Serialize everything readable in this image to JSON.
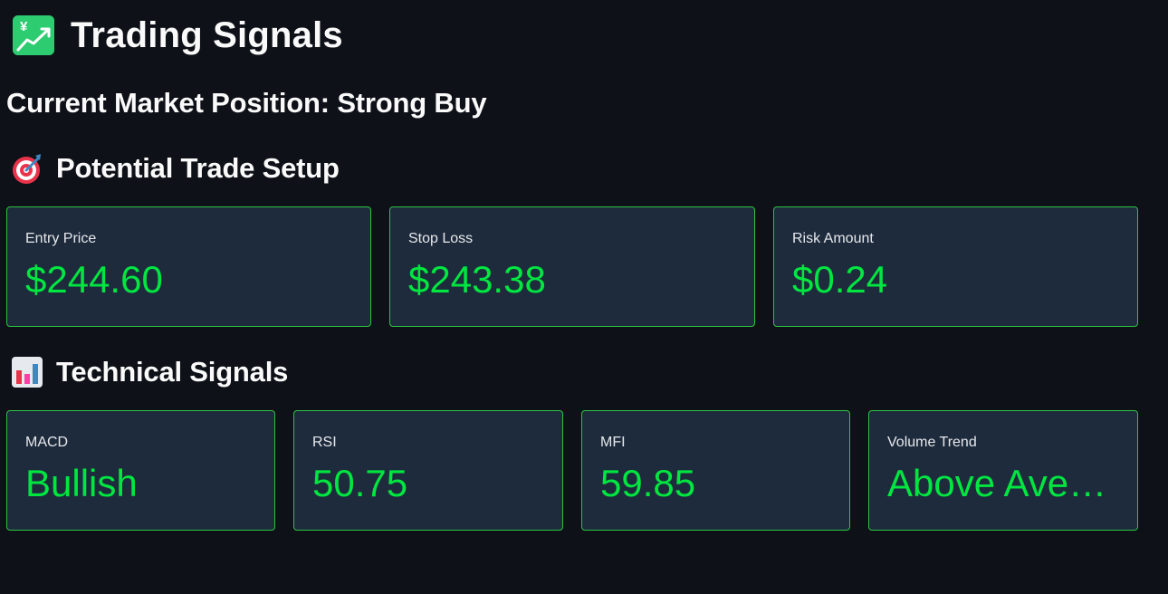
{
  "header": {
    "title": "Trading Signals",
    "icon": "chart-increasing-icon",
    "icon_symbol": "¥"
  },
  "market": {
    "position_text": "Current Market Position: Strong Buy"
  },
  "trade_setup": {
    "heading": "Potential Trade Setup",
    "icon": "direct-hit-icon",
    "metrics": [
      {
        "label": "Entry Price",
        "value": "$244.60"
      },
      {
        "label": "Stop Loss",
        "value": "$243.38"
      },
      {
        "label": "Risk Amount",
        "value": "$0.24"
      }
    ]
  },
  "technical": {
    "heading": "Technical Signals",
    "icon": "bar-chart-icon",
    "metrics": [
      {
        "label": "MACD",
        "value": "Bullish"
      },
      {
        "label": "RSI",
        "value": "50.75"
      },
      {
        "label": "MFI",
        "value": "59.85"
      },
      {
        "label": "Volume Trend",
        "value": "Above Average"
      }
    ]
  },
  "colors": {
    "background": "#0e1117",
    "card_background": "#1e2b3d",
    "card_border": "#2ec240",
    "value_green": "#00e640",
    "text": "#fafafa"
  }
}
